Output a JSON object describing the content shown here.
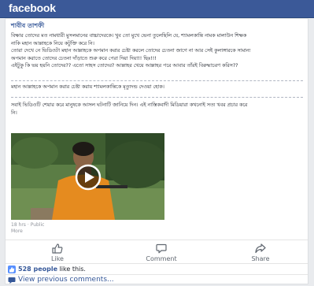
{
  "header": {
    "logo": "facebook",
    "brand_color": "#3b5998"
  },
  "post": {
    "author": "শাবীব তাশফী",
    "paragraphs": [
      "বিক্ষার তোদের মত নামধারী মুসলমানের বাচ্চাদেরকে। খুব তো মুখে ভেনা তুলেছিলি যে, শ্যামলকান্তি নামক মালাউন শিক্ষক",
      "নাকি মহান আল্লাহকে নিয়ে কটুক্তি করে নি।",
      "তোরা দেখে নে ভিডিওটা মহান আল্লাহকে অপমান করার চেষ্টা করলে তোদের চেতনা জাগে না আর সেই কুলাঙ্গারকে সামান্য",
      "অপমান করাতে তোদের চেতনা দাঁড়াতে শুরু করে পেরা দিয়া দিয়া!! ছিঃ!!!",
      "এইটুকু কি ভয় হয়নি তোদের?? এতো সাহস তোদের? আল্লাহর খেয়ে আল্লাহর পরে আবার তাঁরই বিরুদ্ধাচরণ করিস??"
    ],
    "highlight": "মহান আল্লাহকে অপমান করার চেষ্টা করায় শ্যামলকান্তিকে মৃত্যুদন্ড দেওয়া হোক।",
    "closing": [
      "সবাই ভিডিওটি শেয়ার করে মানুষকে আসল ঘটনাটি জানিয়ে দিন। এই নাস্তিকবাদী মিডিয়ারা কখনোই সত্য খবর প্রচার করে",
      "নি।"
    ],
    "meta": {
      "time": "18 hrs",
      "separator": "·",
      "privacy": "Public",
      "more": "More"
    }
  },
  "actions": {
    "like": "Like",
    "comment": "Comment",
    "share": "Share"
  },
  "likes": {
    "count": "528 people",
    "suffix": " like this."
  },
  "comments": {
    "view_previous": "View previous comments..."
  }
}
